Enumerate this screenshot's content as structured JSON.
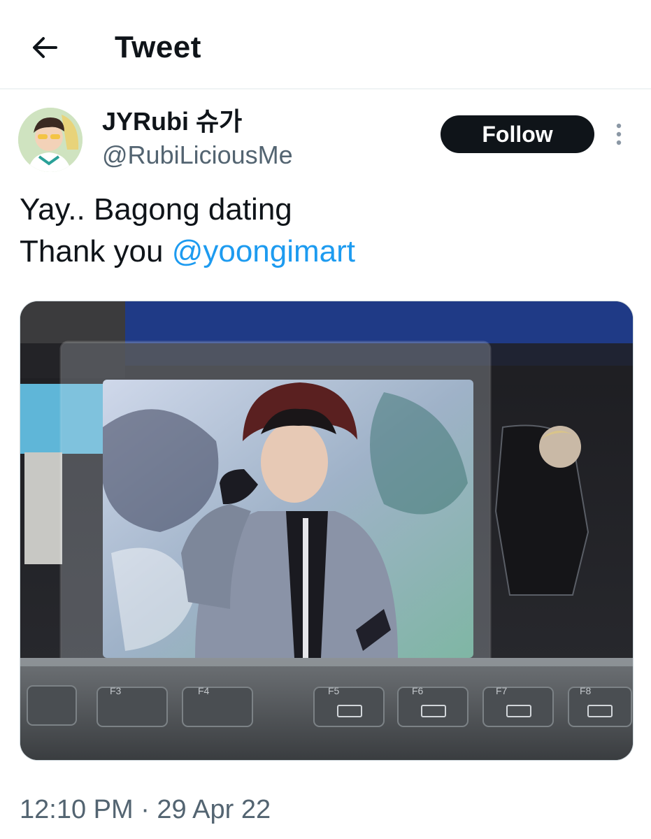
{
  "header": {
    "title": "Tweet",
    "back_icon": "arrow-left-icon"
  },
  "author": {
    "display_name": "JYRubi 슈가",
    "handle": "@RubiLiciousMe",
    "avatar_icon": "avatar-illustration"
  },
  "actions": {
    "follow_label": "Follow",
    "more_icon": "more-vertical-icon"
  },
  "tweet": {
    "line1": "Yay.. Bagong dating",
    "line2_prefix": "Thank you ",
    "mention": "@yoongimart"
  },
  "media": {
    "keys": [
      "F3",
      "F4",
      "F5",
      "F6",
      "F7",
      "F8"
    ]
  },
  "meta": {
    "timestamp": "12:10 PM · 29 Apr 22"
  },
  "colors": {
    "text": "#0f1419",
    "secondary": "#536471",
    "link": "#1d9bf0",
    "follow_bg": "#0f1419",
    "divider": "#eff3f4"
  }
}
